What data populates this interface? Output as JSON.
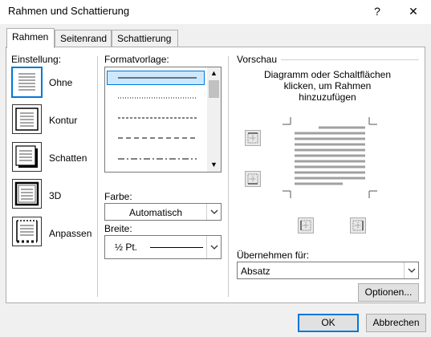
{
  "window": {
    "title": "Rahmen und Schattierung",
    "help_label": "?",
    "close_label": "✕"
  },
  "tabs": [
    {
      "label": "Rahmen",
      "active": true
    },
    {
      "label": "Seitenrand",
      "active": false
    },
    {
      "label": "Schattierung",
      "active": false
    }
  ],
  "einstellung": {
    "heading": "Einstellung:",
    "options": [
      {
        "label": "Ohne",
        "icon": "setting-none-icon",
        "selected": true
      },
      {
        "label": "Kontur",
        "icon": "setting-box-icon",
        "selected": false
      },
      {
        "label": "Schatten",
        "icon": "setting-shadow-icon",
        "selected": false
      },
      {
        "label": "3D",
        "icon": "setting-3d-icon",
        "selected": false
      },
      {
        "label": "Anpassen",
        "icon": "setting-custom-icon",
        "selected": false
      }
    ]
  },
  "formatvorlage": {
    "heading": "Formatvorlage:",
    "styles": [
      "solid",
      "dotted",
      "dashed-small",
      "dashed",
      "dash-dot"
    ],
    "selected_index": 0
  },
  "farbe": {
    "label": "Farbe:",
    "value": "Automatisch"
  },
  "breite": {
    "label": "Breite:",
    "value": "½ Pt."
  },
  "vorschau": {
    "heading": "Vorschau",
    "hint_line1": "Diagramm oder Schaltflächen",
    "hint_line2": "klicken, um Rahmen",
    "hint_line3": "hinzuzufügen"
  },
  "apply": {
    "label": "Übernehmen für:",
    "value": "Absatz"
  },
  "buttons": {
    "optionen": "Optionen...",
    "ok": "OK",
    "abbrechen": "Abbrechen"
  },
  "colors": {
    "accent": "#0078d7",
    "selection": "#cce8ff",
    "preview_lines": "#a0a0a0"
  }
}
